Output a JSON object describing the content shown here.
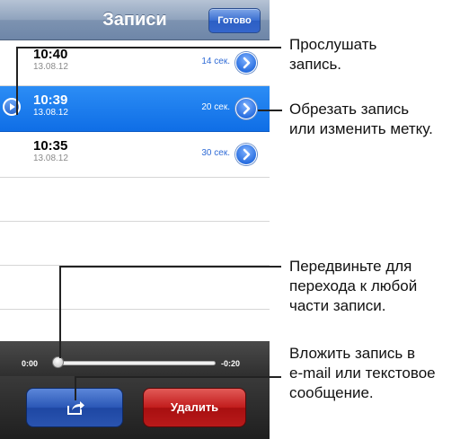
{
  "navbar": {
    "title": "Записи",
    "done_label": "Готово"
  },
  "recordings": [
    {
      "time": "10:40",
      "date": "13.08.12",
      "duration": "14 сек.",
      "selected": false
    },
    {
      "time": "10:39",
      "date": "13.08.12",
      "duration": "20 сек.",
      "selected": true
    },
    {
      "time": "10:35",
      "date": "13.08.12",
      "duration": "30 сек.",
      "selected": false
    }
  ],
  "player": {
    "elapsed": "0:00",
    "remaining": "-0:20",
    "progress": 0.0
  },
  "toolbar": {
    "share_icon": "share-icon",
    "delete_label": "Удалить"
  },
  "callouts": {
    "play_l1": "Прослушать",
    "play_l2": "запись.",
    "edit_l1": "Обрезать запись",
    "edit_l2": "или изменить метку.",
    "scrub_l1": "Передвиньте для",
    "scrub_l2": "перехода к любой",
    "scrub_l3": "части записи.",
    "share_l1": "Вложить запись в",
    "share_l2": "e-mail или текстовое",
    "share_l3": "сообщение."
  },
  "colors": {
    "selection": "#1a7ef0",
    "delete": "#c11c1c",
    "share": "#2a57b6"
  }
}
